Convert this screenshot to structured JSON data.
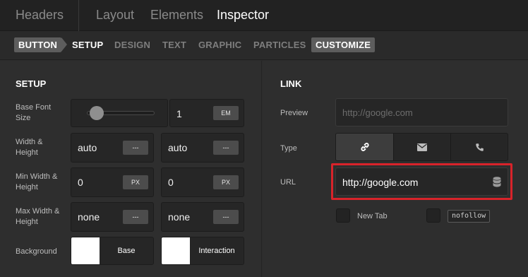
{
  "topbar": {
    "headers": "Headers",
    "tabs": [
      "Layout",
      "Elements",
      "Inspector"
    ],
    "active_tab": "Inspector"
  },
  "subtabs": {
    "items": [
      "BUTTON",
      "SETUP",
      "DESIGN",
      "TEXT",
      "GRAPHIC",
      "PARTICLES",
      "CUSTOMIZE"
    ],
    "active": "SETUP"
  },
  "setup": {
    "title": "SETUP",
    "base_font_size": {
      "label": "Base Font Size",
      "value": "1",
      "unit": "EM"
    },
    "width_height": {
      "label": "Width & Height",
      "width": "auto",
      "height": "auto",
      "unit": "---"
    },
    "min_width_height": {
      "label": "Min Width & Height",
      "width": "0",
      "height": "0",
      "unit": "PX"
    },
    "max_width_height": {
      "label": "Max Width & Height",
      "width": "none",
      "height": "none",
      "unit": "---"
    },
    "background": {
      "label": "Background",
      "base": "Base",
      "interaction": "Interaction",
      "base_color": "#ffffff",
      "interaction_color": "#ffffff"
    }
  },
  "link": {
    "title": "LINK",
    "preview": {
      "label": "Preview",
      "placeholder": "http://google.com"
    },
    "type": {
      "label": "Type",
      "options": [
        "link-icon",
        "envelope-icon",
        "phone-icon"
      ],
      "selected": "link-icon"
    },
    "url": {
      "label": "URL",
      "value": "http://google.com"
    },
    "new_tab": {
      "label": "New Tab"
    },
    "nofollow": {
      "label": "nofollow"
    }
  },
  "colors": {
    "highlight": "#d8232a",
    "background": "#2c2c2c"
  }
}
